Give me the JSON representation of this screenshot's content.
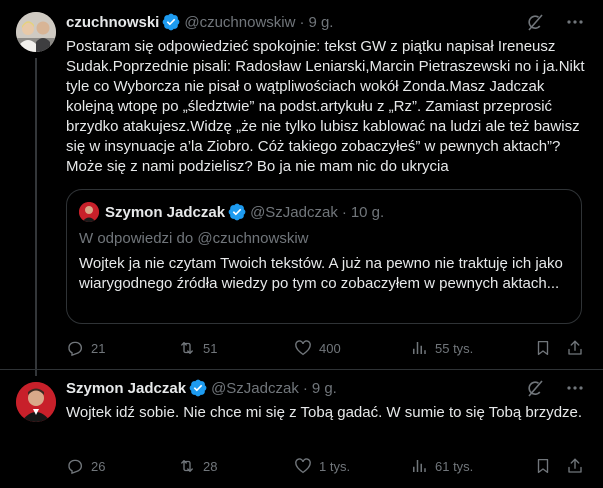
{
  "tweet1": {
    "name": "czuchnowski",
    "handle": "@czuchnowskiw",
    "dot": "·",
    "time": "9 g.",
    "text": "Postaram się odpowiedzieć spokojnie: tekst GW z piątku napisał Ireneusz Sudak.Poprzednie pisali: Radosław Leniarski,Marcin Pietraszewski no i ja.Nikt tyle co Wyborcza nie pisał o wątpliwościach wokół Zonda.Masz Jadczak kolejną wtopę po „śledztwie” na podst.artykułu z „Rz”. Zamiast przeprosić brzydko atakujesz.Widzę „że nie tylko lubisz kablować na ludzi ale też bawisz się w insynuacje a’la Ziobro. Cóż takiego zobaczyłeś” w pewnych aktach”? Może się z nami podzielisz? Bo ja nie mam nic do ukrycia",
    "quote": {
      "name": "Szymon Jadczak",
      "handle": "@SzJadczak",
      "dot": "·",
      "time": "10 g.",
      "reply_to": "W odpowiedzi do @czuchnowskiw",
      "text": "Wojtek ja nie czytam Twoich tekstów. A już na pewno nie traktuję ich jako wiarygodnego źródła wiedzy po tym co zobaczyłem w pewnych aktach..."
    },
    "stats": {
      "replies": "21",
      "retweets": "51",
      "likes": "400",
      "views": "55 tys."
    }
  },
  "tweet2": {
    "name": "Szymon Jadczak",
    "handle": "@SzJadczak",
    "dot": "·",
    "time": "9 g.",
    "text": "Wojtek idź sobie. Nie chce mi się z Tobą gadać. W sumie to się Tobą brzydze.",
    "stats": {
      "replies": "26",
      "retweets": "28",
      "likes": "1 tys.",
      "views": "61 tys."
    }
  },
  "colors": {
    "background": "#000000",
    "text": "#e7e9ea",
    "muted": "#71767b",
    "border": "#2f3336",
    "verified": "#1d9bf0"
  },
  "icons": [
    "verified-badge-icon",
    "grok-icon",
    "more-icon",
    "reply-icon",
    "retweet-icon",
    "like-icon",
    "views-icon",
    "bookmark-icon",
    "share-icon"
  ]
}
